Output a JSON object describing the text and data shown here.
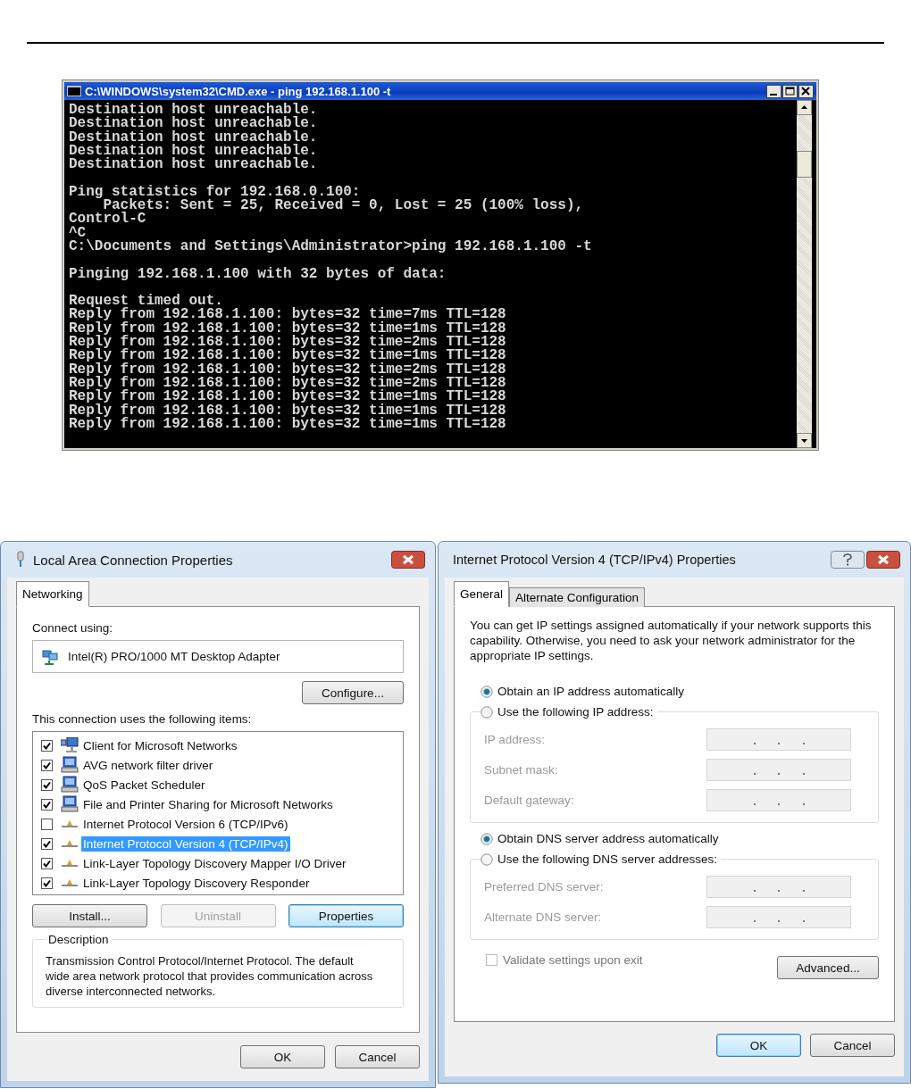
{
  "console_window": {
    "title": "C:\\WINDOWS\\system32\\CMD.exe - ping 192.168.1.100 -t",
    "blocks": [
      [
        "Destination host unreachable.",
        "Destination host unreachable.",
        "Destination host unreachable.",
        "Destination host unreachable.",
        "Destination host unreachable."
      ],
      [
        "Ping statistics for 192.168.0.100:",
        "    Packets: Sent = 25, Received = 0, Lost = 25 (100% loss),",
        "Control-C",
        "^C",
        "C:\\Documents and Settings\\Administrator>ping 192.168.1.100 -t"
      ],
      [
        "Pinging 192.168.1.100 with 32 bytes of data:"
      ],
      [
        "Request timed out.",
        "Reply from 192.168.1.100: bytes=32 time=7ms TTL=128",
        "Reply from 192.168.1.100: bytes=32 time=1ms TTL=128",
        "Reply from 192.168.1.100: bytes=32 time=2ms TTL=128",
        "Reply from 192.168.1.100: bytes=32 time=1ms TTL=128",
        "Reply from 192.168.1.100: bytes=32 time=2ms TTL=128",
        "Reply from 192.168.1.100: bytes=32 time=2ms TTL=128",
        "Reply from 192.168.1.100: bytes=32 time=1ms TTL=128",
        "Reply from 192.168.1.100: bytes=32 time=1ms TTL=128",
        "Reply from 192.168.1.100: bytes=32 time=1ms TTL=128"
      ]
    ]
  },
  "connection_dialog": {
    "title": "Local Area Connection Properties",
    "tabs": [
      {
        "label": "Networking",
        "selected": true
      }
    ],
    "connect_using_label": "Connect using:",
    "adapter": "Intel(R) PRO/1000 MT Desktop Adapter",
    "configure_button": "Configure...",
    "items_label": "This connection uses the following items:",
    "items": [
      {
        "kind": "client",
        "label": "Client for Microsoft Networks",
        "checked": true,
        "selected": false
      },
      {
        "kind": "service",
        "label": "AVG network filter driver",
        "checked": true,
        "selected": false
      },
      {
        "kind": "service",
        "label": "QoS Packet Scheduler",
        "checked": true,
        "selected": false
      },
      {
        "kind": "service",
        "label": "File and Printer Sharing for Microsoft Networks",
        "checked": true,
        "selected": false
      },
      {
        "kind": "protocol",
        "label": "Internet Protocol Version 6 (TCP/IPv6)",
        "checked": false,
        "selected": false
      },
      {
        "kind": "protocol",
        "label": "Internet Protocol Version 4 (TCP/IPv4)",
        "checked": true,
        "selected": true
      },
      {
        "kind": "protocol",
        "label": "Link-Layer Topology Discovery Mapper I/O Driver",
        "checked": true,
        "selected": false
      },
      {
        "kind": "protocol",
        "label": "Link-Layer Topology Discovery Responder",
        "checked": true,
        "selected": false
      }
    ],
    "item_buttons": [
      {
        "label": "Install...",
        "disabled": false,
        "default": false
      },
      {
        "label": "Uninstall",
        "disabled": true,
        "default": false
      },
      {
        "label": "Properties",
        "disabled": false,
        "default": true
      }
    ],
    "description": {
      "title": "Description",
      "text": "Transmission Control Protocol/Internet Protocol. The default wide area network protocol that provides communication across diverse interconnected networks."
    },
    "footer_buttons": [
      {
        "label": "OK",
        "default": false
      },
      {
        "label": "Cancel",
        "default": false
      }
    ]
  },
  "ipv4_dialog": {
    "title": "Internet Protocol Version 4 (TCP/IPv4) Properties",
    "tabs": [
      {
        "label": "General",
        "selected": true
      },
      {
        "label": "Alternate Configuration",
        "selected": false
      }
    ],
    "intro": "You can get IP settings assigned automatically if your network supports this capability. Otherwise, you need to ask your network administrator for the appropriate IP settings.",
    "ip_options": [
      {
        "label": "Obtain an IP address automatically",
        "selected": true
      },
      {
        "label": "Use the following IP address:",
        "selected": false
      }
    ],
    "ip_fields": [
      {
        "label": "IP address:",
        "disabled": true
      },
      {
        "label": "Subnet mask:",
        "disabled": true
      },
      {
        "label": "Default gateway:",
        "disabled": true
      }
    ],
    "dns_options": [
      {
        "label": "Obtain DNS server address automatically",
        "selected": true
      },
      {
        "label": "Use the following DNS server addresses:",
        "selected": false
      }
    ],
    "dns_fields": [
      {
        "label": "Preferred DNS server:",
        "disabled": true
      },
      {
        "label": "Alternate DNS server:",
        "disabled": true
      }
    ],
    "validate": {
      "label": "Validate settings upon exit",
      "checked": false,
      "disabled": true
    },
    "advanced_button": "Advanced...",
    "footer_buttons": [
      {
        "label": "OK",
        "default": true
      },
      {
        "label": "Cancel",
        "default": false
      }
    ]
  }
}
